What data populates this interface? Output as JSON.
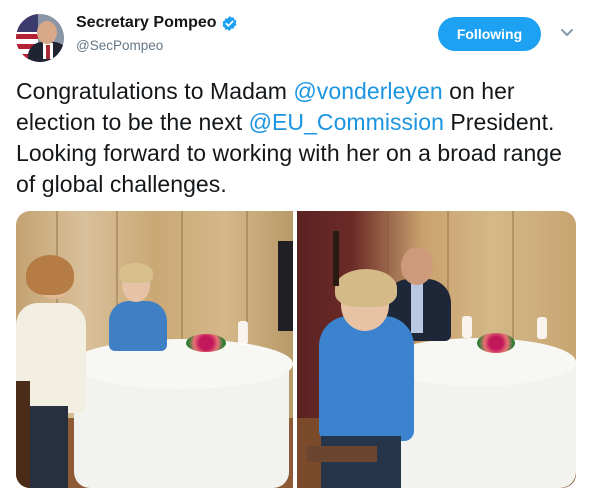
{
  "account": {
    "display_name": "Secretary Pompeo",
    "handle": "@SecPompeo",
    "verified": true,
    "avatar_icon": "profile-photo-avatar"
  },
  "follow_button": {
    "label": "Following"
  },
  "menu_icon": "chevron-down-icon",
  "tweet": {
    "segments": [
      {
        "text": "Congratulations to Madam ",
        "type": "text"
      },
      {
        "text": "@vonderleyen",
        "type": "mention"
      },
      {
        "text": " on her election to be the next ",
        "type": "text"
      },
      {
        "text": "@EU_Commission",
        "type": "mention"
      },
      {
        "text": " President. Looking forward to working with her on a broad range of global challenges.",
        "type": "text"
      }
    ]
  },
  "media": {
    "photos": [
      {
        "description": "two women seated at round dining table"
      },
      {
        "description": "woman in blue jacket and man in suit at round dining table"
      }
    ]
  },
  "colors": {
    "accent": "#1da1f2",
    "mention": "#1b95e0",
    "text": "#14171a",
    "secondary": "#657786"
  }
}
